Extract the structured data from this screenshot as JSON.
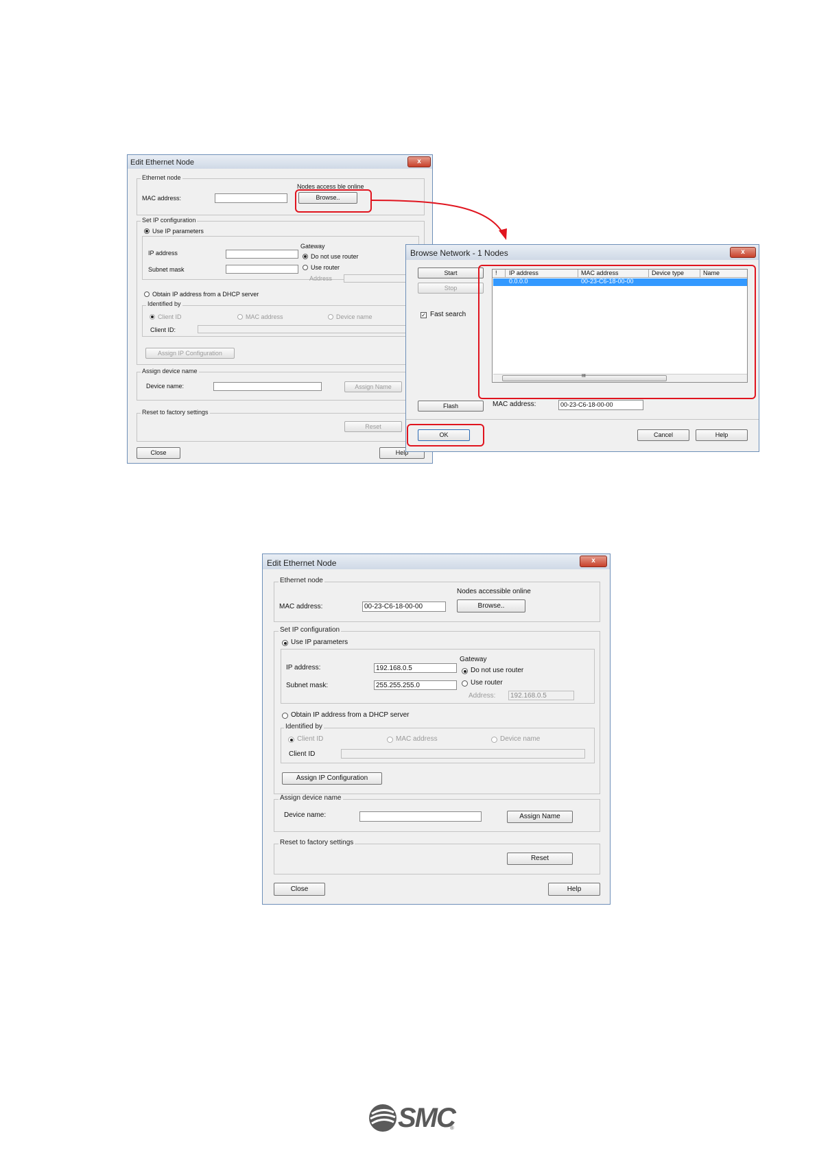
{
  "figure1": {
    "edit_dialog": {
      "title": "Edit Ethernet Node",
      "close_glyph": "x",
      "ethernet_node": {
        "group": "Ethernet node",
        "mac_label": "MAC address:",
        "mac_value": "",
        "nodes_online": "Nodes access ble online",
        "browse_button": "Browse.."
      },
      "ip_config": {
        "group": "Set IP configuration",
        "use_ip": "Use IP parameters",
        "ip_label": "IP address",
        "ip_value": "",
        "subnet_label": "Subnet mask",
        "subnet_value": "",
        "gateway": "Gateway",
        "no_router": "Do not use router",
        "use_router": "Use router",
        "address_label": "Address",
        "address_value": "",
        "dhcp": "Obtain IP address from a DHCP server",
        "identified_by": "Identified by",
        "client_id_radio": "Client ID",
        "mac_radio": "MAC address",
        "device_name_radio": "Device name",
        "client_id_label": "Client ID:",
        "client_id_value": "",
        "assign_ip_button": "Assign IP Configuration"
      },
      "assign_name": {
        "group": "Assign device name",
        "device_label": "Device name:",
        "device_value": "",
        "assign_button": "Assign Name"
      },
      "reset": {
        "group": "Reset to factory settings",
        "reset_button": "Reset"
      },
      "close_button": "Close",
      "help_button": "Help"
    },
    "browse_dialog": {
      "title": "Browse Network - 1 Nodes",
      "close_glyph": "x",
      "start_button": "Start",
      "stop_button": "Stop",
      "fast_search": "Fast search",
      "flash_button": "Flash",
      "columns": [
        "!",
        "IP address",
        "MAC address",
        "Device type",
        "Name"
      ],
      "rows": [
        {
          "ip": "0.0.0.0",
          "mac": "00-23-C6-18-00-00"
        }
      ],
      "scroll_glyph": "III",
      "mac_label": "MAC address:",
      "mac_value": "00-23-C6-18-00-00",
      "ok_button": "OK",
      "cancel_button": "Cancel",
      "help_button": "Help"
    }
  },
  "figure2": {
    "title": "Edit Ethernet Node",
    "close_glyph": "x",
    "ethernet_node": {
      "group": "Ethernet node",
      "mac_label": "MAC address:",
      "mac_value": "00-23-C6-18-00-00",
      "nodes_online": "Nodes accessible online",
      "browse_button": "Browse.."
    },
    "ip_config": {
      "group": "Set IP configuration",
      "use_ip": "Use IP parameters",
      "ip_label": "IP address:",
      "ip_value": "192.168.0.5",
      "subnet_label": "Subnet mask:",
      "subnet_value": "255.255.255.0",
      "gateway": "Gateway",
      "no_router": "Do not use router",
      "use_router": "Use router",
      "address_label": "Address:",
      "address_value": "192.168.0.5",
      "dhcp": "Obtain IP address from a DHCP server",
      "identified_by": "Identified by",
      "client_id_radio": "Client ID",
      "mac_radio": "MAC address",
      "device_name_radio": "Device name",
      "client_id_label": "Client ID",
      "client_id_value": "",
      "assign_ip_button": "Assign IP Configuration"
    },
    "assign_name": {
      "group": "Assign device name",
      "device_label": "Device name:",
      "device_value": "",
      "assign_button": "Assign Name"
    },
    "reset": {
      "group": "Reset to factory settings",
      "reset_button": "Reset"
    },
    "close_button": "Close",
    "help_button": "Help"
  },
  "footer": {
    "logo_text": "SMC",
    "registered": "®"
  },
  "colors": {
    "highlight": "#e0141e",
    "selection": "#3399ff",
    "logo": "#5a5a5a"
  }
}
